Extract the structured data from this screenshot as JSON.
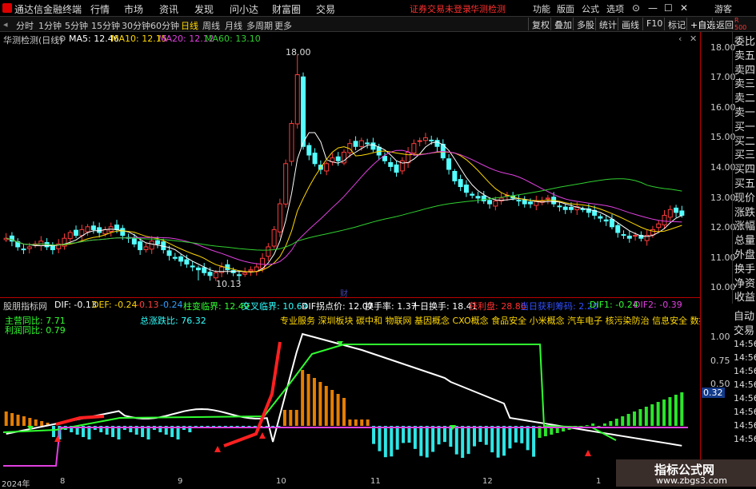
{
  "menu": {
    "brand": "通达信金融终端",
    "items": [
      "行情",
      "市场",
      "资讯",
      "发现",
      "问小达",
      "财富圈",
      "交易"
    ],
    "notice": "证券交易未登录",
    "notice2": "华测检测",
    "right": [
      "功能",
      "版面",
      "公式",
      "选项"
    ],
    "guest": "游客"
  },
  "timeframes": [
    "分时",
    "1分钟",
    "5分钟",
    "15分钟",
    "30分钟",
    "60分钟",
    "日线",
    "周线",
    "月线",
    "多周期",
    "更多"
  ],
  "active_timeframe": "日线",
  "toolbar_right": [
    "复权",
    "叠加",
    "多股",
    "统计",
    "画线",
    "F10",
    "标记",
    "+自选",
    "返回"
  ],
  "ma_header": {
    "stock": "华测检测(日线)",
    "ma5": "MA5: 12.46",
    "ma10": "MA10: 12.15",
    "ma20": "MA20: 12.12",
    "ma60": "MA60: 13.10"
  },
  "price_axis": [
    "18.00",
    "17.00",
    "16.00",
    "15.00",
    "14.00",
    "13.00",
    "12.00",
    "11.00",
    "10.00"
  ],
  "annotations": {
    "high": "18.00",
    "low": "10.13",
    "cai": "财"
  },
  "side_nav": [
    "委比",
    "卖五",
    "卖四",
    "卖三",
    "卖二",
    "卖一",
    "买一",
    "买二",
    "买三",
    "买四",
    "买五",
    "现价",
    "涨跌",
    "涨幅",
    "总量",
    "外盘",
    "换手",
    "净资",
    "收益"
  ],
  "ind_header": {
    "name": "股朋指标网",
    "dif": "DIF: -0.13",
    "def": "DEF: -0.24",
    "v1": "-0.13",
    "v2": "-0.24",
    "zhu": "柱变临界: 12.49",
    "jiao": "交叉临界: 10.64",
    "dif_pt": "DIF拐点价: 12.07",
    "hsl": "换手率: 1.37",
    "sr": "十日换手: 18.41",
    "ly": "获利盘: 28.86",
    "dr": "当日获利筹码: 2.20",
    "dif1": "DIF1: -0.24",
    "dif2": "DIF2: -0.39"
  },
  "ind_left": {
    "yy": "主营同比: 7.71",
    "lr": "利润同比: 0.79",
    "zdb": "总涨跌比: 76.32"
  },
  "concept_text": "专业服务 深圳板块 碳中和 物联网 基因概念 CXO概念 食品安全 小米概念 汽车电子 核污染防治 信息安全 数据中心 机器人概",
  "ind_axis": [
    "1.00",
    "0.75",
    "0.50",
    "0.32"
  ],
  "date_axis": [
    "2024年",
    "8",
    "9",
    "10",
    "11",
    "12",
    "1"
  ],
  "right_bottom": {
    "auto": "自动",
    "trade": "交易",
    "times": [
      "14:56",
      "14:56",
      "14:56",
      "14:56",
      "14:56",
      "14:56",
      "14:56",
      "14:56"
    ]
  },
  "watermark": {
    "title": "指标公式网",
    "url": "www.zbgs3.com"
  },
  "chart_data": {
    "type": "candlestick",
    "ylim": [
      9.6,
      18.4
    ],
    "close": [
      11.6,
      11.5,
      11.3,
      11.2,
      11.3,
      11.4,
      11.5,
      11.3,
      11.2,
      11.4,
      11.6,
      11.8,
      11.7,
      11.9,
      12.0,
      11.9,
      11.8,
      11.9,
      12.0,
      11.9,
      11.7,
      11.6,
      11.4,
      11.2,
      11.3,
      11.5,
      11.4,
      11.2,
      11.0,
      10.9,
      10.8,
      10.7,
      10.6,
      10.5,
      10.4,
      10.3,
      10.4,
      10.6,
      10.5,
      10.4,
      10.3,
      10.4,
      10.5,
      10.6,
      10.9,
      11.3,
      11.9,
      12.8,
      14.2,
      15.6,
      17.3,
      14.8,
      14.5,
      14.2,
      14.0,
      14.2,
      14.4,
      14.3,
      14.6,
      14.9,
      14.8,
      15.0,
      14.9,
      14.7,
      14.5,
      14.3,
      14.1,
      13.9,
      14.3,
      14.6,
      14.9,
      15.0,
      15.1,
      15.0,
      14.8,
      14.4,
      14.0,
      13.6,
      13.4,
      13.2,
      13.1,
      13.0,
      12.9,
      12.8,
      12.9,
      13.0,
      13.1,
      13.0,
      12.9,
      12.8,
      12.8,
      12.9,
      12.9,
      13.0,
      12.8,
      12.7,
      12.6,
      12.6,
      12.7,
      12.6,
      12.5,
      12.4,
      12.3,
      12.2,
      12.0,
      11.8,
      11.7,
      11.6,
      11.7,
      11.6,
      11.7,
      11.9,
      12.1,
      12.4,
      12.6,
      12.5,
      12.4
    ],
    "ma60_shape": "rising then falling from ~14.0 to ~13.1"
  }
}
